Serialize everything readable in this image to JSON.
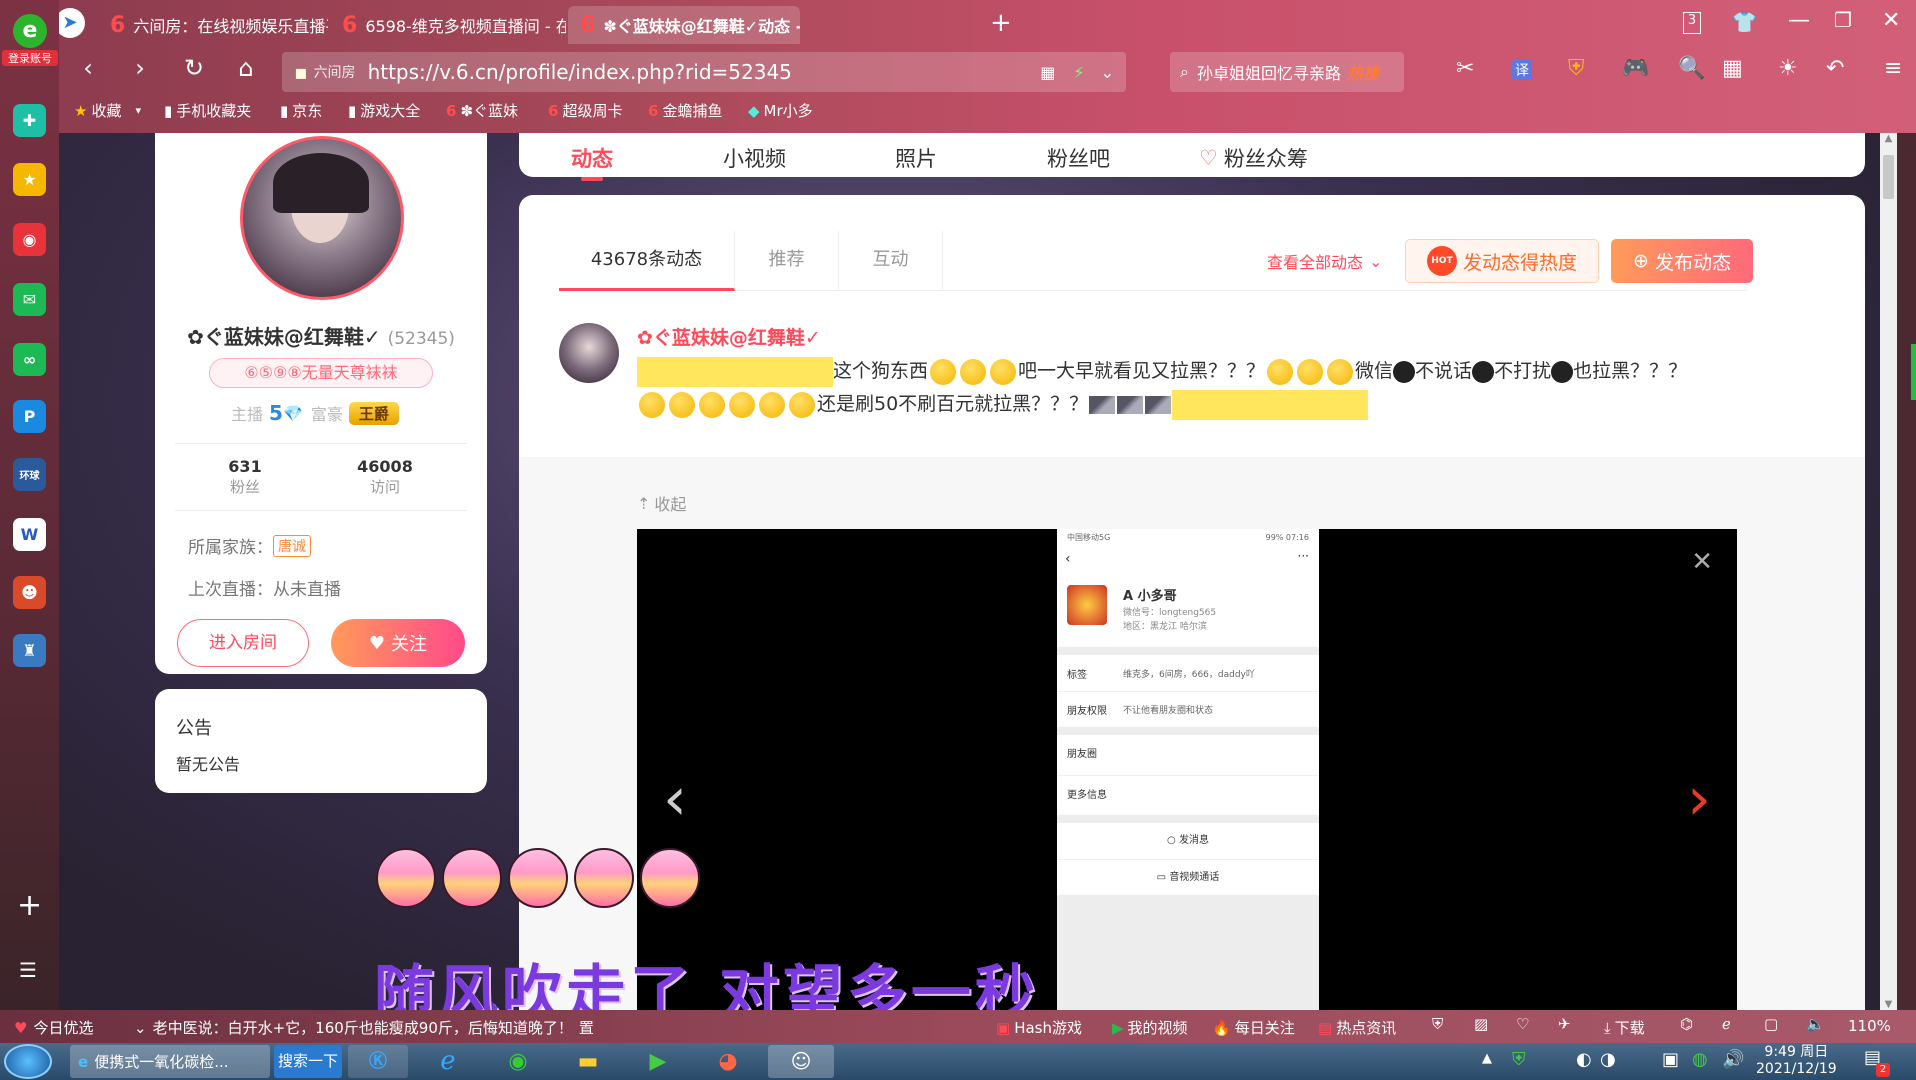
{
  "browser": {
    "tabs": [
      {
        "label": "六间房：在线视频娱乐直播平"
      },
      {
        "label": "6598-维克多视频直播间 - 在线"
      },
      {
        "label": "✽ぐ蓝妹妹@红舞鞋✓动态 - 在"
      }
    ],
    "tab_count": "3",
    "url": "https://v.6.cn/profile/index.php?rid=52345",
    "site_tag": "六间房",
    "search_placeholder": "孙卓姐姐回忆寻亲路",
    "search_hot": "热搜",
    "bookmarks": [
      "收藏",
      "手机收藏夹",
      "京东",
      "游戏大全",
      "✽ぐ蓝妹",
      "超级周卡",
      "金蟾捕鱼",
      "Mr小多"
    ],
    "login_label": "登录账号"
  },
  "profile": {
    "name": "✿ぐ蓝妹妹@红舞鞋✓",
    "room_id": "(52345)",
    "badge": "⑥⑤⑨⑧无量天尊袜袜",
    "anchor_label": "主播",
    "anchor_level": "5",
    "rich_label": "富豪",
    "rich_badge": "王爵",
    "fans_count": "631",
    "fans_label": "粉丝",
    "visits_count": "46008",
    "visits_label": "访问",
    "family_label": "所属家族：",
    "family_value": "唐诚",
    "last_live": "上次直播：从未直播",
    "enter_room": "进入房间",
    "follow": "关注"
  },
  "notice": {
    "title": "公告",
    "text": "暂无公告"
  },
  "nav": {
    "tabs": [
      "动态",
      "小视频",
      "照片",
      "粉丝吧",
      "粉丝众筹"
    ]
  },
  "feed": {
    "subtabs": [
      "43678条动态",
      "推荐",
      "互动"
    ],
    "view_all": "查看全部动态",
    "hot_button": "发动态得热度",
    "publish_button": "发布动态",
    "hot_badge": "HOT",
    "post": {
      "author": "✿ぐ蓝妹妹@红舞鞋✓",
      "text1": "这个狗东西",
      "text2": "吧一大早就看见又拉黑？？？",
      "text3": "微信",
      "text4": "不说话",
      "text5": "不打扰",
      "text6": "也拉黑？？？",
      "text7": "还是刷50不刷百元就拉黑？？？",
      "collapse": "收起"
    }
  },
  "phone": {
    "status_left": "中国移动5G",
    "status_right": "99% 07:16",
    "contact_name": "A 小多哥",
    "wechat_id": "微信号：longteng565",
    "region": "地区：黑龙江 哈尔滨",
    "tags_label": "标签",
    "tags_value": "维克多，6间房，666，daddy吖",
    "perm_label": "朋友权限",
    "perm_value": "不让他看朋友圈和状态",
    "moments": "朋友圈",
    "more_info": "更多信息",
    "send_msg": "发消息",
    "video_call": "音视频通话"
  },
  "lyrics": "随风吹走了 对望多一秒",
  "statusbar": {
    "left1": "今日优选",
    "news": "老中医说：白开水+它，160斤也能瘦成90斤，后悔知道晚了！",
    "news_tag": "置",
    "hash_games": "Hash游戏",
    "my_video": "我的视频",
    "daily": "每日关注",
    "hot_info": "热点资讯",
    "download": "下载",
    "zoom": "110%"
  },
  "taskbar": {
    "item1": "便携式一氧化碳检...",
    "item2": "搜索一下",
    "time": "9:49 周日",
    "date": "2021/12/19",
    "notify_count": "2"
  },
  "colors": {
    "accent": "#ff4a5a",
    "orange": "#ff8a4a",
    "brand_red": "#e8394a"
  }
}
